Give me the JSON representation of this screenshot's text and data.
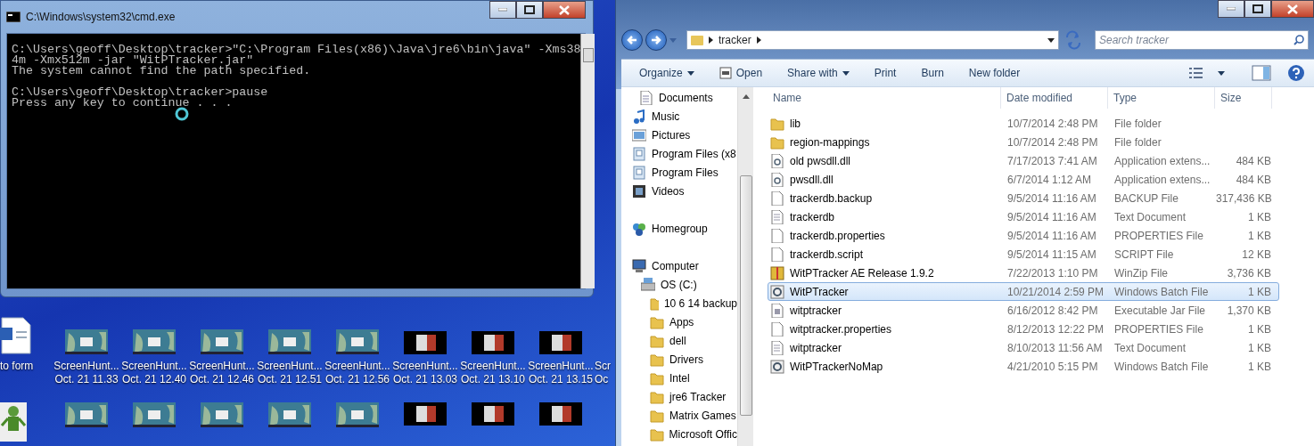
{
  "console_window": {
    "title": "C:\\Windows\\system32\\cmd.exe",
    "blocks": [
      [
        "C:\\Users\\geoff\\Desktop\\tracker>\"C:\\Program Files(x86)\\Java\\jre6\\bin\\java\" -Xms38",
        "4m -Xmx512m -jar \"WitPTracker.jar\"",
        "The system cannot find the path specified."
      ],
      [
        "C:\\Users\\geoff\\Desktop\\tracker>pause",
        "Press any key to continue . . ."
      ]
    ]
  },
  "desktop": {
    "icons": [
      {
        "kind": "document",
        "lines": [
          "to form"
        ]
      },
      {
        "kind": "map",
        "lines": [
          "ScreenHunt...",
          "Oct. 21 11.33"
        ]
      },
      {
        "kind": "map",
        "lines": [
          "ScreenHunt...",
          "Oct. 21 12.40"
        ]
      },
      {
        "kind": "map",
        "lines": [
          "ScreenHunt...",
          "Oct. 21 12.46"
        ]
      },
      {
        "kind": "map",
        "lines": [
          "ScreenHunt...",
          "Oct. 21 12.51"
        ]
      },
      {
        "kind": "map",
        "lines": [
          "ScreenHunt...",
          "Oct. 21 12.56"
        ]
      },
      {
        "kind": "dark",
        "lines": [
          "ScreenHunt...",
          "Oct. 21 13.03"
        ]
      },
      {
        "kind": "dark",
        "lines": [
          "ScreenHunt...",
          "Oct. 21 13.10"
        ]
      },
      {
        "kind": "dark",
        "lines": [
          "ScreenHunt...",
          "Oct. 21 13.15"
        ]
      },
      {
        "kind": "none",
        "lines": [
          "Scr",
          "Oc"
        ]
      }
    ],
    "second_row": [
      {
        "kind": "figure"
      },
      {
        "kind": "map"
      },
      {
        "kind": "map"
      },
      {
        "kind": "map"
      },
      {
        "kind": "map"
      },
      {
        "kind": "map"
      },
      {
        "kind": "dark"
      },
      {
        "kind": "dark"
      },
      {
        "kind": "dark"
      }
    ]
  },
  "explorer": {
    "breadcrumb": [
      "tracker"
    ],
    "search": {
      "placeholder": "Search tracker"
    },
    "toolbar": [
      {
        "label": "Organize",
        "kind": "menu"
      },
      {
        "label": "Open",
        "kind": "icon"
      },
      {
        "label": "Share with",
        "kind": "menu"
      },
      {
        "label": "Print",
        "kind": "plain"
      },
      {
        "label": "Burn",
        "kind": "plain"
      },
      {
        "label": "New folder",
        "kind": "plain"
      }
    ],
    "nav_groups": [
      [
        {
          "label": "Documents",
          "kind": "documents"
        },
        {
          "label": "Music",
          "kind": "music"
        },
        {
          "label": "Pictures",
          "kind": "pictures"
        },
        {
          "label": "Program Files (x8",
          "kind": "drive"
        },
        {
          "label": "Program Files",
          "kind": "drive"
        },
        {
          "label": "Videos",
          "kind": "videos"
        }
      ],
      [
        {
          "label": "Homegroup",
          "kind": "homegroup"
        }
      ],
      [
        {
          "label": "Computer",
          "kind": "computer",
          "children": [
            {
              "label": "OS (C:)",
              "kind": "disk",
              "children": [
                {
                  "label": "10 6 14 backup",
                  "kind": "folder"
                },
                {
                  "label": "Apps",
                  "kind": "folder"
                },
                {
                  "label": "dell",
                  "kind": "folder"
                },
                {
                  "label": "Drivers",
                  "kind": "folder"
                },
                {
                  "label": "Intel",
                  "kind": "folder"
                },
                {
                  "label": "jre6 Tracker",
                  "kind": "folder"
                },
                {
                  "label": "Matrix Games",
                  "kind": "folder"
                },
                {
                  "label": "Microsoft Offic",
                  "kind": "folder"
                }
              ]
            }
          ]
        }
      ]
    ],
    "columns": [
      "Name",
      "Date modified",
      "Type",
      "Size"
    ],
    "rows": [
      {
        "kind": "folder",
        "name": "lib",
        "date": "10/7/2014 2:48 PM",
        "type": "File folder",
        "selected": false
      },
      {
        "kind": "folder",
        "name": "region-mappings",
        "date": "10/7/2014 2:48 PM",
        "type": "File folder",
        "selected": false
      },
      {
        "kind": "dll",
        "name": "old pwsdll.dll",
        "date": "7/17/2013 7:41 AM",
        "type": "Application extens...",
        "size": "484 KB",
        "selected": false
      },
      {
        "kind": "dll",
        "name": "pwsdll.dll",
        "date": "6/7/2014 1:12 AM",
        "type": "Application extens...",
        "size": "484 KB",
        "selected": false
      },
      {
        "kind": "file",
        "name": "trackerdb.backup",
        "date": "9/5/2014 11:16 AM",
        "type": "BACKUP File",
        "size": "317,436 KB",
        "selected": false
      },
      {
        "kind": "text",
        "name": "trackerdb",
        "date": "9/5/2014 11:16 AM",
        "type": "Text Document",
        "size": "1 KB",
        "selected": false
      },
      {
        "kind": "file",
        "name": "trackerdb.properties",
        "date": "9/5/2014 11:16 AM",
        "type": "PROPERTIES File",
        "size": "1 KB",
        "selected": false
      },
      {
        "kind": "file",
        "name": "trackerdb.script",
        "date": "9/5/2014 11:15 AM",
        "type": "SCRIPT File",
        "size": "12 KB",
        "selected": false
      },
      {
        "kind": "zip",
        "name": "WitPTracker AE Release 1.9.2",
        "date": "7/22/2013 1:10 PM",
        "type": "WinZip File",
        "size": "3,736 KB",
        "selected": false
      },
      {
        "kind": "batch",
        "name": "WitPTracker",
        "date": "10/21/2014 2:59 PM",
        "type": "Windows Batch File",
        "size": "1 KB",
        "selected": true
      },
      {
        "kind": "jar",
        "name": "witptracker",
        "date": "6/16/2012 8:42 PM",
        "type": "Executable Jar File",
        "size": "1,370 KB",
        "selected": false
      },
      {
        "kind": "file",
        "name": "witptracker.properties",
        "date": "8/12/2013 12:22 PM",
        "type": "PROPERTIES File",
        "size": "1 KB",
        "selected": false
      },
      {
        "kind": "text",
        "name": "witptracker",
        "date": "8/10/2013 11:56 AM",
        "type": "Text Document",
        "size": "1 KB",
        "selected": false
      },
      {
        "kind": "batch",
        "name": "WitPTrackerNoMap",
        "date": "4/21/2010 5:15 PM",
        "type": "Windows Batch File",
        "size": "1 KB",
        "selected": false
      }
    ]
  }
}
